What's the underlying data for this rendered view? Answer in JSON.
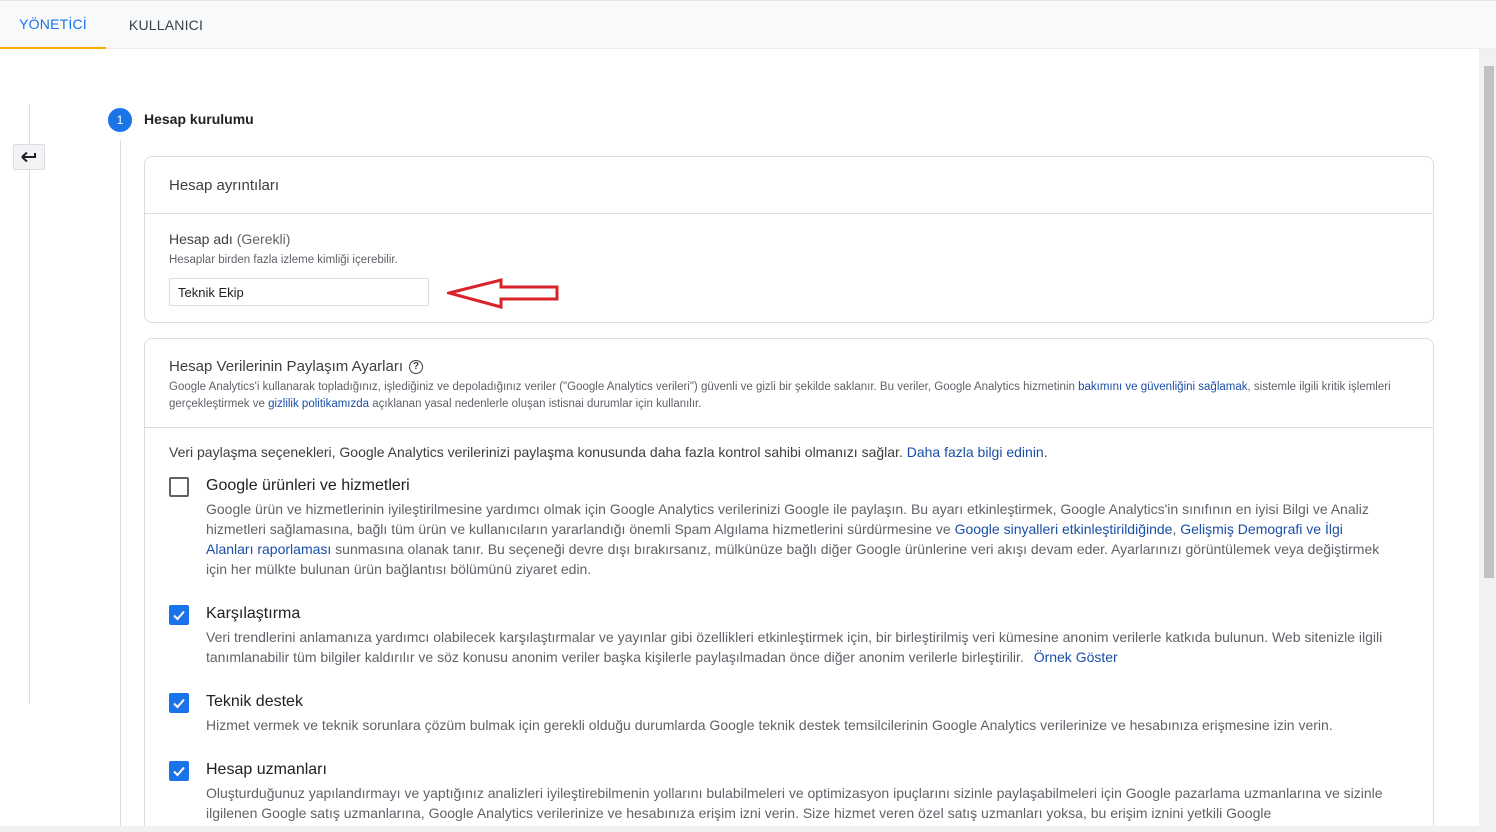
{
  "tabs": [
    {
      "label": "YÖNETİCİ",
      "active": true
    },
    {
      "label": "KULLANICI",
      "active": false
    }
  ],
  "back_button": {
    "icon": "back-arrow-icon"
  },
  "stepper": {
    "number": "1",
    "title": "Hesap kurulumu"
  },
  "account_details": {
    "header": "Hesap ayrıntıları",
    "field_label": "Hesap adı",
    "field_required": "(Gerekli)",
    "field_help": "Hesaplar birden fazla izleme kimliği içerebilir.",
    "field_value": "Teknik Ekip"
  },
  "sharing": {
    "title": "Hesap Verilerinin Paylaşım Ayarları",
    "help_icon": "?",
    "desc_part1": "Google Analytics'i kullanarak topladığınız, işlediğiniz ve depoladığınız veriler (\"Google Analytics verileri\") güvenli ve gizli bir şekilde saklanır. Bu veriler, Google Analytics hizmetinin ",
    "desc_link1": "bakımını ve güvenliğini sağlamak",
    "desc_part2": ", sistemle ilgili kritik işlemleri gerçekleştirmek ve ",
    "desc_link2": "gizlilik politikamızda",
    "desc_part3": " açıklanan yasal nedenlerle oluşan istisnai durumlar için kullanılır.",
    "intro_text": "Veri paylaşma seçenekleri, Google Analytics verilerinizi paylaşma konusunda daha fazla kontrol sahibi olmanızı sağlar. ",
    "intro_link": "Daha fazla bilgi edinin",
    "intro_end": ".",
    "options": [
      {
        "title": "Google ürünleri ve hizmetleri",
        "checked": false,
        "desc_part1": "Google ürün ve hizmetlerinin iyileştirilmesine yardımcı olmak için Google Analytics verilerinizi Google ile paylaşın. Bu ayarı etkinleştirmek, Google Analytics'in sınıfının en iyisi Bilgi ve Analiz hizmetleri sağlamasına, bağlı tüm ürün ve kullanıcıların yararlandığı önemli Spam Algılama hizmetlerini sürdürmesine ve ",
        "desc_link1": "Google sinyalleri etkinleştirildiğinde",
        "desc_sep": ", ",
        "desc_link2": "Gelişmiş Demografi ve İlgi Alanları raporlaması",
        "desc_part2": " sunmasına olanak tanır. Bu seçeneği devre dışı bırakırsanız, mülkünüze bağlı diğer Google ürünlerine veri akışı devam eder. Ayarlarınızı görüntülemek veya değiştirmek için her mülkte bulunan ürün bağlantısı bölümünü ziyaret edin."
      },
      {
        "title": "Karşılaştırma",
        "checked": true,
        "desc_part1": "Veri trendlerini anlamanıza yardımcı olabilecek karşılaştırmalar ve yayınlar gibi özellikleri etkinleştirmek için, bir birleştirilmiş veri kümesine anonim verilerle katkıda bulunun. Web sitenizle ilgili tanımlanabilir tüm bilgiler kaldırılır ve söz konusu anonim veriler başka kişilerle paylaşılmadan önce diğer anonim verilerle birleştirilir. ",
        "desc_link1": "Örnek Göster"
      },
      {
        "title": "Teknik destek",
        "checked": true,
        "desc_part1": "Hizmet vermek ve teknik sorunlara çözüm bulmak için gerekli olduğu durumlarda Google teknik destek temsilcilerinin Google Analytics verilerinize ve hesabınıza erişmesine izin verin."
      },
      {
        "title": "Hesap uzmanları",
        "checked": true,
        "desc_part1": "Oluşturduğunuz yapılandırmayı ve yaptığınız analizleri iyileştirebilmenin yollarını bulabilmeleri ve optimizasyon ipuçlarını sizinle paylaşabilmeleri için Google pazarlama uzmanlarına ve sizinle ilgilenen Google satış uzmanlarına, Google Analytics verilerinize ve hesabınıza erişim izni verin. Size hizmet veren özel satış uzmanları yoksa, bu erişim iznini yetkili Google"
      }
    ]
  },
  "colors": {
    "accent": "#1a73e8",
    "tab_underline": "#f9ab00",
    "annotation_arrow": "#d9232a"
  }
}
